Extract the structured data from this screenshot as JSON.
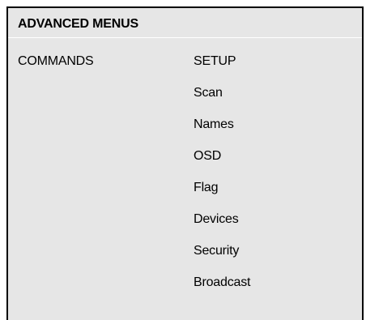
{
  "table": {
    "title": "ADVANCED MENUS",
    "left_label": "COMMANDS",
    "menu_items": [
      "SETUP",
      "Scan",
      "Names",
      "OSD",
      "Flag",
      "Devices",
      "Security",
      "Broadcast"
    ]
  }
}
